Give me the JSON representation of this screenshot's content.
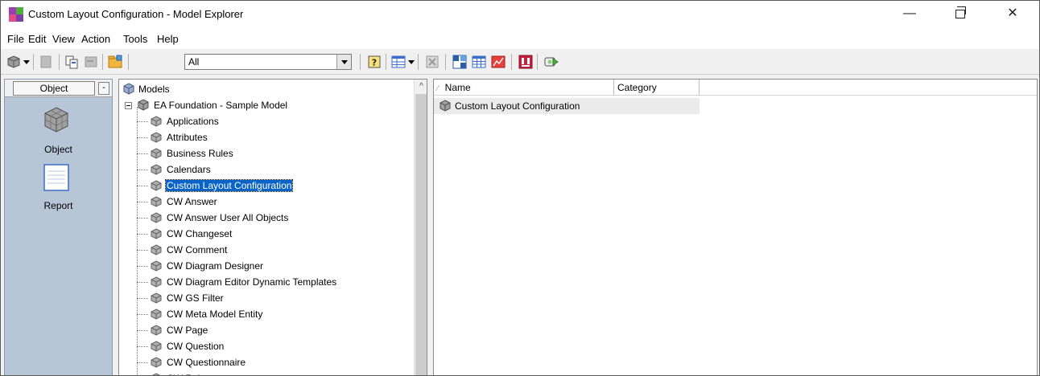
{
  "window": {
    "title": "Custom Layout Configuration - Model Explorer",
    "controls": {
      "minimize": "—",
      "maximize": "",
      "close": "✕"
    }
  },
  "menu": [
    {
      "label": "File"
    },
    {
      "label": "Edit"
    },
    {
      "label": "View"
    },
    {
      "label": "Action"
    },
    {
      "label": "Tools"
    },
    {
      "label": "Help"
    }
  ],
  "toolbar": {
    "filter_value": "All",
    "icons": [
      "model-icon",
      "disabled-icon",
      "copy-icon",
      "disabled-icon",
      "folder-icon",
      "help-icon",
      "grid-view-icon",
      "delete-icon",
      "layout-icon",
      "table-icon",
      "chart-icon",
      "report-icon",
      "run-icon"
    ]
  },
  "left_panel": {
    "header": "Object",
    "collapse": "-",
    "items": [
      {
        "label": "Object",
        "icon": "object-cube-icon"
      },
      {
        "label": "Report",
        "icon": "report-page-icon"
      }
    ]
  },
  "tree": {
    "root": "Models",
    "model": "EA Foundation - Sample Model",
    "items": [
      "Applications",
      "Attributes",
      "Business Rules",
      "Calendars",
      "Custom Layout Configuration",
      "CW Answer",
      "CW Answer User All Objects",
      "CW Changeset",
      "CW Comment",
      "CW Diagram Designer",
      "CW Diagram Editor Dynamic Templates",
      "CW GS Filter",
      "CW Meta Model Entity",
      "CW Page",
      "CW Question",
      "CW Questionnaire",
      "CW Role"
    ],
    "selected": "Custom Layout Configuration",
    "scroll_up": "^"
  },
  "list": {
    "columns": [
      "Name",
      "Category"
    ],
    "rows": [
      {
        "name": "Custom Layout Configuration",
        "category": ""
      }
    ]
  }
}
